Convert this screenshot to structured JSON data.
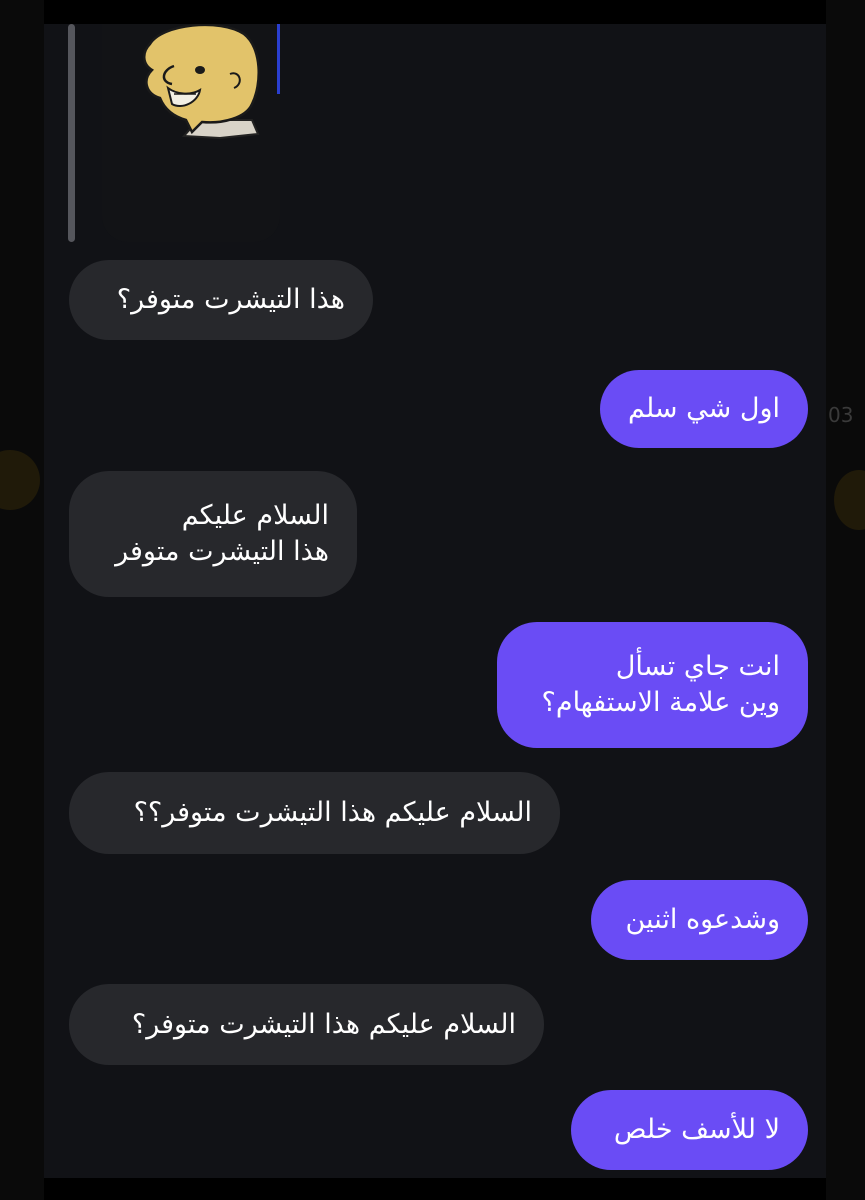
{
  "conversation": {
    "messages": [
      {
        "direction": "incoming",
        "lines": [
          "هذا التيشرت متوفر؟"
        ]
      },
      {
        "direction": "outgoing",
        "lines": [
          "اول شي سلم"
        ]
      },
      {
        "direction": "incoming",
        "lines": [
          "السلام عليكم",
          "هذا التيشرت متوفر"
        ]
      },
      {
        "direction": "outgoing",
        "lines": [
          "انت جاي تسأل",
          "وين علامة الاستفهام؟"
        ]
      },
      {
        "direction": "incoming",
        "lines": [
          "السلام عليكم هذا التيشرت متوفر؟؟"
        ]
      },
      {
        "direction": "outgoing",
        "lines": [
          "وشدعوه اثنين"
        ]
      },
      {
        "direction": "incoming",
        "lines": [
          "السلام عليكم هذا التيشرت متوفر؟"
        ]
      },
      {
        "direction": "outgoing",
        "lines": [
          "لا للأسف خلص"
        ]
      }
    ]
  },
  "background_text": "03",
  "colors": {
    "incoming_bubble": "#27282c",
    "outgoing_bubble": "#6a4cf5",
    "chat_background": "#111216",
    "text": "#ffffff"
  },
  "icons": {
    "shared_image": "cartoon-face-image"
  }
}
